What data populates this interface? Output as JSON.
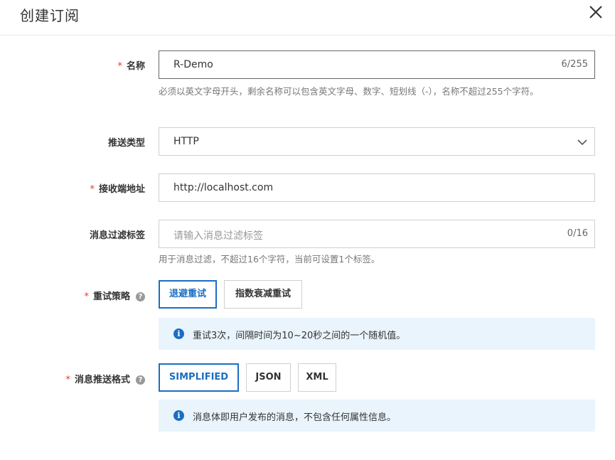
{
  "dialog": {
    "title": "创建订阅",
    "close_icon": "close-icon"
  },
  "form": {
    "name": {
      "required": true,
      "label": "名称",
      "value": "R-Demo",
      "counter": "6/255",
      "hint": "必须以英文字母开头，剩余名称可以包含英文字母、数字、短划线（-），名称不超过255个字符。"
    },
    "push_type": {
      "label": "推送类型",
      "value": "HTTP",
      "icon": "chevron-down-icon"
    },
    "endpoint": {
      "required": true,
      "label": "接收端地址",
      "value": "http://localhost.com"
    },
    "filter_tag": {
      "label": "消息过滤标签",
      "placeholder": "请输入消息过滤标签",
      "counter": "0/16",
      "hint": "用于消息过滤，不超过16个字符，当前可设置1个标签。"
    },
    "retry_policy": {
      "required": true,
      "label": "重试策略",
      "help_icon": "?",
      "options": [
        "退避重试",
        "指数衰减重试"
      ],
      "selected": "退避重试",
      "info": "重试3次，间隔时间为10~20秒之间的一个随机值。"
    },
    "message_format": {
      "required": true,
      "label": "消息推送格式",
      "help_icon": "?",
      "options": [
        "SIMPLIFIED",
        "JSON",
        "XML"
      ],
      "selected": "SIMPLIFIED",
      "info": "消息体即用户发布的消息，不包含任何属性信息。"
    },
    "required_mark": "*",
    "info_icon": "i"
  },
  "colors": {
    "accent": "#1b6ec2",
    "required": "#e0392b",
    "info_bg": "#eaf4fc"
  }
}
